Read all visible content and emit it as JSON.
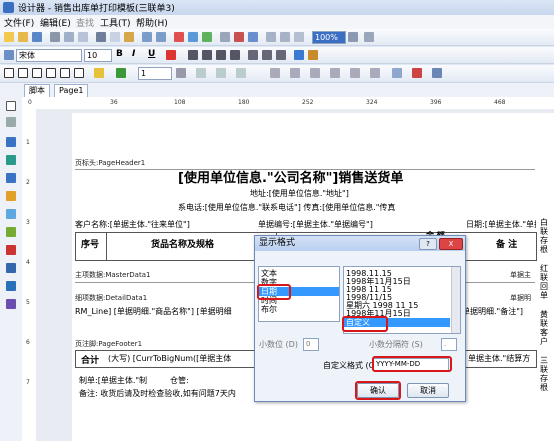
{
  "window": {
    "title": "设计器 - 销售出库单打印模板(三联单3)"
  },
  "menu": [
    "文件(F)",
    "编辑(E)",
    "查找",
    "工具(T)",
    "帮助(H)"
  ],
  "toolbar": {
    "font_name": "宋体",
    "font_size": "10",
    "bold": "B",
    "italic": "I",
    "underline": "U",
    "zoom": "100%",
    "border_width": "1"
  },
  "tabs": [
    "脚本",
    "Page1"
  ],
  "ruler": {
    "h_marks": [
      "0",
      "36",
      "72",
      "108",
      "144",
      "180",
      "216",
      "252",
      "288",
      "324",
      "360",
      "396",
      "432",
      "468",
      "504"
    ],
    "v_marks": [
      "0",
      "1",
      "2",
      "3",
      "4",
      "5",
      "6",
      "7"
    ]
  },
  "report": {
    "page_header_band": "页标头:PageHeader1",
    "title": "[使用单位信息.\"公司名称\"]销售送货单",
    "address": "地址:[使用单位信息.\"地址\"]",
    "contact": "系电话:[使用单位信息.\"联系电话\"]  传真:[使用单位信息.\"传真",
    "customer": "客户名称:[单据主体.\"往来单位\"]",
    "doc_no": "单据编号:[单据主体.\"单据编号\"]",
    "date": "日期:[单据主体.\"单据日期",
    "col_no": "序号",
    "col_name": "货品名称及规格",
    "col_remark": "备 注",
    "col_amount": "金 额",
    "master_band": "主项数据:MasterData1",
    "master_right": "单据主",
    "detail_band": "细项数据:DetailData1",
    "detail_right": "单据明",
    "detail_row": "RM_Line] [单据明细.\"商品名称\"] [单据明细",
    "detail_remark": "单据明细.\"备注\"]",
    "footer_band": "页注脚:PageFooter1",
    "total_label": "合计",
    "total_upper": "(大写) [CurrToBigNum([单据主体",
    "total_right": "单据主体.\"结算方",
    "maker": "制单:[单据主体.\"制",
    "warehouse": "仓管:",
    "note": "备注: 收货后请及时检查验收,如有问题7天内",
    "side_labels": [
      "白联存根",
      "红联回单",
      "黄联客户",
      "三联存根"
    ]
  },
  "dialog": {
    "title": "显示格式",
    "help_btn": "?",
    "close_btn": "X",
    "categories": [
      "文本",
      "数字",
      "日期",
      "时间",
      "布尔"
    ],
    "selected_category": "日期",
    "formats": [
      "1998.11.15",
      "1998年11月15日",
      "1998 11 15",
      "1998/11/15",
      "星期六 1998 11 15",
      "1998年11月15日",
      "自定义"
    ],
    "selected_format": "自定义",
    "decimal_label": "小数位 (D)",
    "decimal_value": "0",
    "separator_label": "小数分隔符 (S)",
    "separator_value": ".",
    "custom_label": "自定义格式 (C)",
    "custom_value": "YYYY-MM-DD",
    "ok_label": "确认",
    "cancel_label": "取消"
  },
  "colors": {
    "accent": "#3399ff",
    "highlight": "#d8171b"
  }
}
